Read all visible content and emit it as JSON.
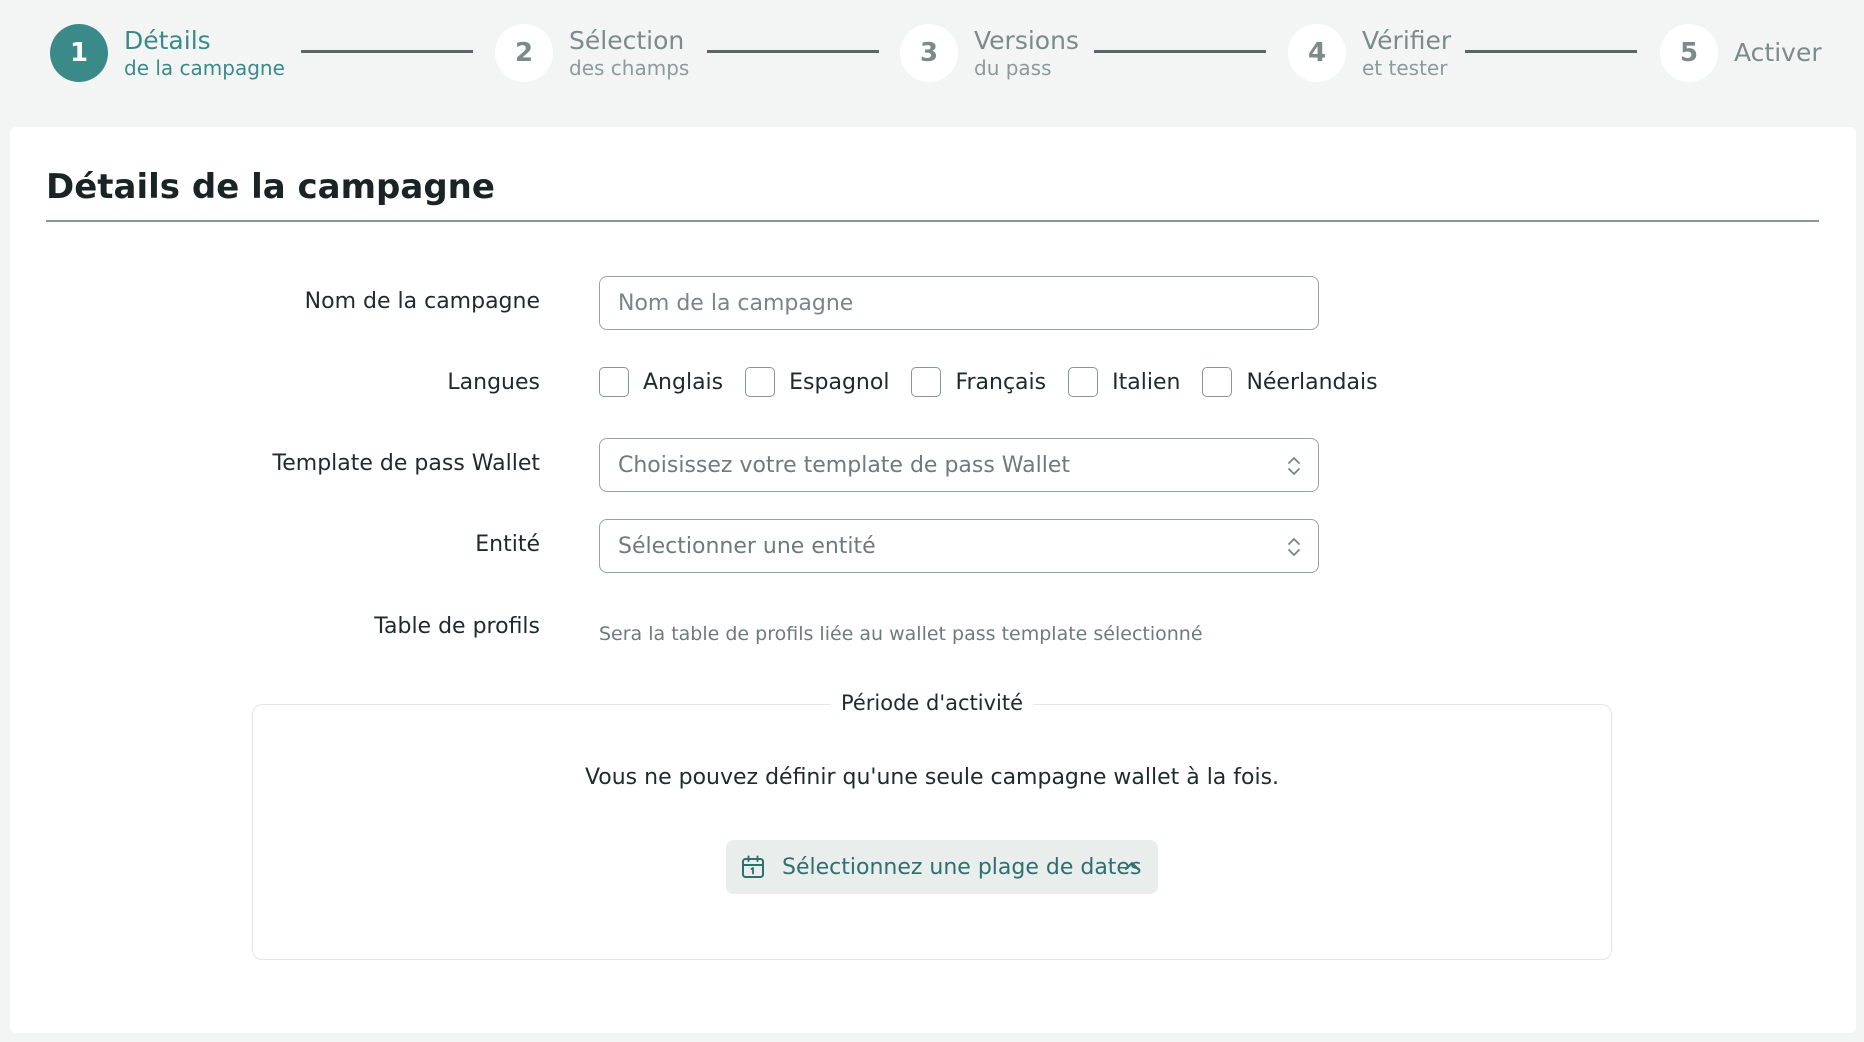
{
  "stepper": {
    "steps": [
      {
        "number": "1",
        "title": "Détails",
        "subtitle": "de la campagne",
        "active": true
      },
      {
        "number": "2",
        "title": "Sélection",
        "subtitle": "des champs",
        "active": false
      },
      {
        "number": "3",
        "title": "Versions",
        "subtitle": "du pass",
        "active": false
      },
      {
        "number": "4",
        "title": "Vérifier",
        "subtitle": "et tester",
        "active": false
      },
      {
        "number": "5",
        "title": "Activer",
        "subtitle": "",
        "active": false
      }
    ]
  },
  "page": {
    "title": "Détails de la campagne"
  },
  "form": {
    "campaign_name": {
      "label": "Nom de la campagne",
      "placeholder": "Nom de la campagne",
      "value": ""
    },
    "languages": {
      "label": "Langues",
      "options": [
        {
          "label": "Anglais",
          "checked": false
        },
        {
          "label": "Espagnol",
          "checked": false
        },
        {
          "label": "Français",
          "checked": false
        },
        {
          "label": "Italien",
          "checked": false
        },
        {
          "label": "Néerlandais",
          "checked": false
        }
      ]
    },
    "template": {
      "label": "Template de pass Wallet",
      "placeholder": "Choisissez votre template de pass Wallet"
    },
    "entity": {
      "label": "Entité",
      "placeholder": "Sélectionner une entité"
    },
    "profiles_table": {
      "label": "Table de profils",
      "helper": "Sera la table de profils liée au wallet pass template sélectionné"
    }
  },
  "period": {
    "legend": "Période d'activité",
    "note": "Vous ne pouvez définir qu'une seule campagne wallet à la fois.",
    "date_button": "Sélectionnez une plage de dates",
    "icons": {
      "calendar": "calendar-icon",
      "chevron": "chevron-up-icon"
    }
  },
  "colors": {
    "accent": "#3b8a8a",
    "background": "#f3f5f4",
    "card": "#ffffff"
  }
}
